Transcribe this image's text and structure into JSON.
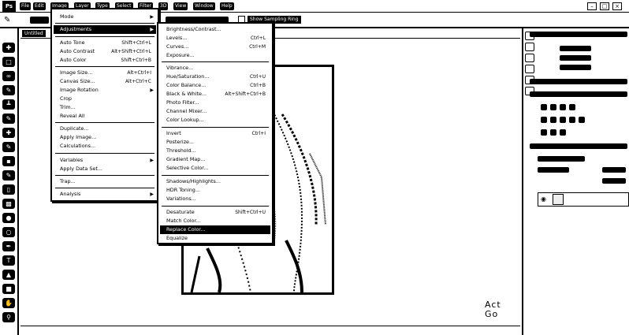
{
  "app": {
    "logo": "Ps"
  },
  "menubar": {
    "items": [
      "File",
      "Edit",
      "Image",
      "Layer",
      "Type",
      "Select",
      "Filter",
      "3D",
      "View",
      "Window",
      "Help"
    ],
    "window_controls": [
      "–",
      "□",
      "×"
    ]
  },
  "options_bar": {
    "sample_all_label": "Show Sampling Ring"
  },
  "document": {
    "tab_label": "Untitled"
  },
  "watermark": {
    "line1": "Act",
    "line2": "Go"
  },
  "image_menu": {
    "items": [
      {
        "label": "Mode",
        "shortcut": "",
        "submenu": true
      },
      {
        "label": "Adjustments",
        "shortcut": "",
        "submenu": true
      },
      {
        "label": "Auto Tone",
        "shortcut": "Shift+Ctrl+L"
      },
      {
        "label": "Auto Contrast",
        "shortcut": "Alt+Shift+Ctrl+L"
      },
      {
        "label": "Auto Color",
        "shortcut": "Shift+Ctrl+B"
      },
      {
        "label": "Image Size...",
        "shortcut": "Alt+Ctrl+I"
      },
      {
        "label": "Canvas Size...",
        "shortcut": "Alt+Ctrl+C"
      },
      {
        "label": "Image Rotation",
        "shortcut": "",
        "submenu": true
      },
      {
        "label": "Crop",
        "shortcut": ""
      },
      {
        "label": "Trim...",
        "shortcut": ""
      },
      {
        "label": "Reveal All",
        "shortcut": ""
      },
      {
        "label": "Duplicate...",
        "shortcut": ""
      },
      {
        "label": "Apply Image...",
        "shortcut": ""
      },
      {
        "label": "Calculations...",
        "shortcut": ""
      },
      {
        "label": "Variables",
        "shortcut": "",
        "submenu": true
      },
      {
        "label": "Apply Data Set...",
        "shortcut": ""
      },
      {
        "label": "Trap...",
        "shortcut": ""
      },
      {
        "label": "Analysis",
        "shortcut": "",
        "submenu": true
      }
    ]
  },
  "adjustments_menu": {
    "items": [
      {
        "label": "Brightness/Contrast...",
        "shortcut": ""
      },
      {
        "label": "Levels...",
        "shortcut": "Ctrl+L"
      },
      {
        "label": "Curves...",
        "shortcut": "Ctrl+M"
      },
      {
        "label": "Exposure...",
        "shortcut": ""
      },
      {
        "label": "Vibrance...",
        "shortcut": ""
      },
      {
        "label": "Hue/Saturation...",
        "shortcut": "Ctrl+U"
      },
      {
        "label": "Color Balance...",
        "shortcut": "Ctrl+B"
      },
      {
        "label": "Black & White...",
        "shortcut": "Alt+Shift+Ctrl+B"
      },
      {
        "label": "Photo Filter...",
        "shortcut": ""
      },
      {
        "label": "Channel Mixer...",
        "shortcut": ""
      },
      {
        "label": "Color Lookup...",
        "shortcut": ""
      },
      {
        "label": "Invert",
        "shortcut": "Ctrl+I"
      },
      {
        "label": "Posterize...",
        "shortcut": ""
      },
      {
        "label": "Threshold...",
        "shortcut": ""
      },
      {
        "label": "Gradient Map...",
        "shortcut": ""
      },
      {
        "label": "Selective Color...",
        "shortcut": ""
      },
      {
        "label": "Shadows/Highlights...",
        "shortcut": ""
      },
      {
        "label": "HDR Toning...",
        "shortcut": ""
      },
      {
        "label": "Variations...",
        "shortcut": ""
      },
      {
        "label": "Desaturate",
        "shortcut": "Shift+Ctrl+U"
      },
      {
        "label": "Match Color...",
        "shortcut": ""
      },
      {
        "label": "Replace Color...",
        "shortcut": ""
      },
      {
        "label": "Equalize",
        "shortcut": ""
      }
    ]
  }
}
